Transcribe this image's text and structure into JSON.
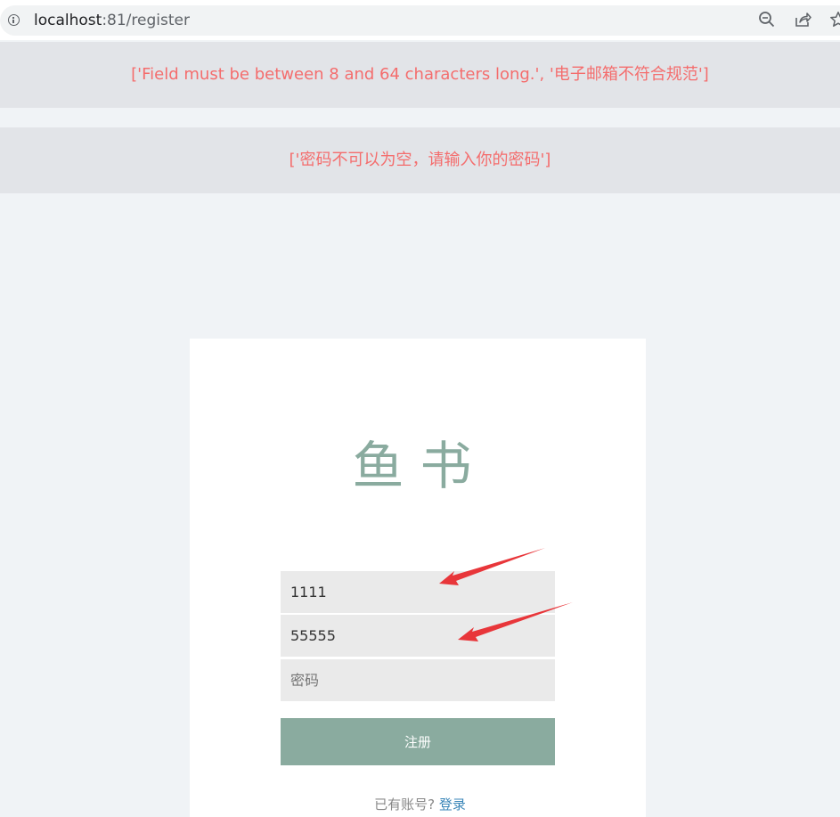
{
  "browser": {
    "url_host": "localhost",
    "url_path": ":81/register",
    "icons": [
      "info-icon",
      "zoom-out-icon",
      "share-icon",
      "star-icon"
    ]
  },
  "flash_messages": [
    "['Field must be between 8 and 64 characters long.', '电子邮箱不符合规范']",
    "['密码不可以为空，请输入你的密码']"
  ],
  "form": {
    "logo": "鱼书",
    "nickname_value": "1111",
    "email_value": "55555",
    "password_placeholder": "密码",
    "submit_label": "注册",
    "has_account_text": "已有账号?",
    "login_link": "登录"
  },
  "colors": {
    "accent": "#8aab9f",
    "error_text": "#f46d6d",
    "flash_bg": "#e2e4e8",
    "page_bg": "#f0f3f6",
    "input_bg": "#eaeaea",
    "link": "#3a86b8",
    "annotation_arrow": "#e8363a"
  }
}
